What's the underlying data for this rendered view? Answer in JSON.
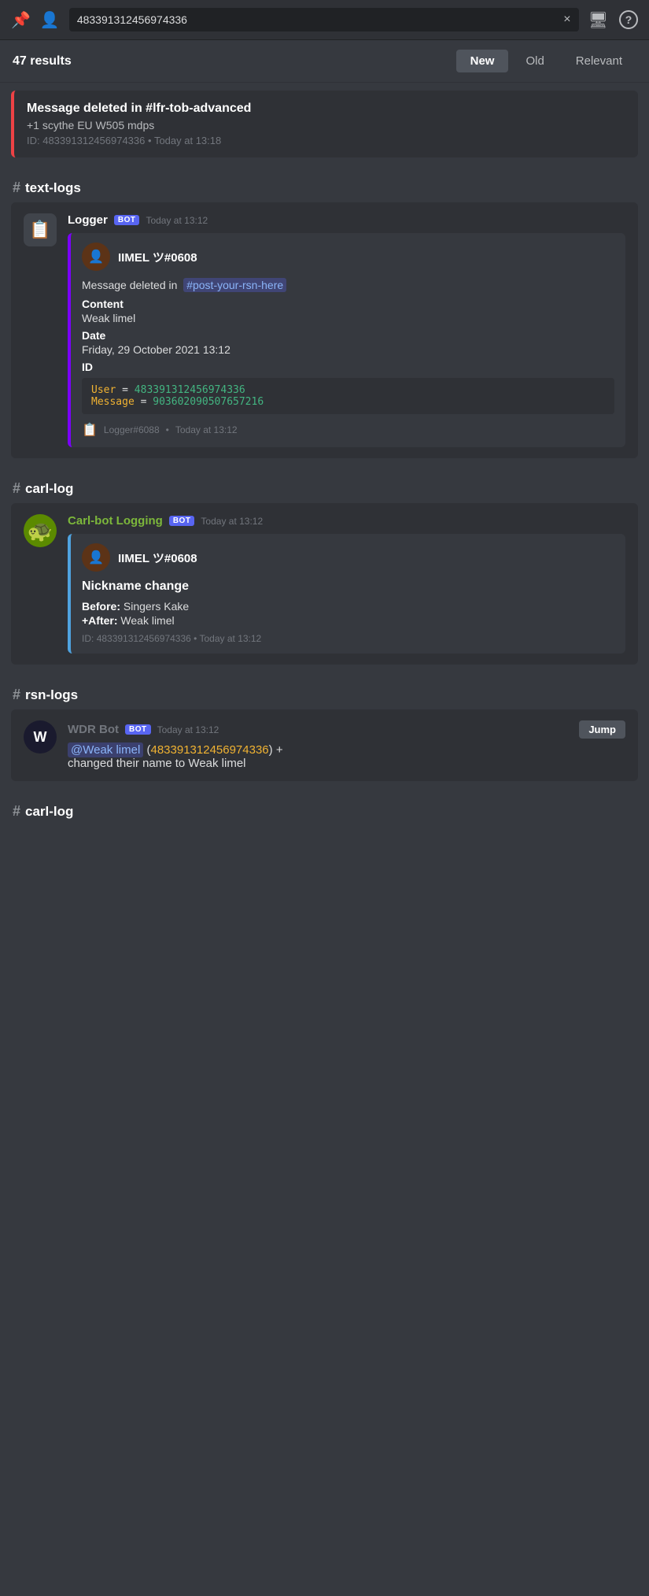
{
  "topbar": {
    "search_value": "483391312456974336",
    "clear_label": "×",
    "chat_icon": "💬",
    "help_icon": "?"
  },
  "results_bar": {
    "count": "47 results",
    "tabs": [
      {
        "label": "New",
        "active": true
      },
      {
        "label": "Old",
        "active": false
      },
      {
        "label": "Relevant",
        "active": false
      }
    ]
  },
  "deleted_snippet": {
    "title": "Message deleted in #lfr-tob-advanced",
    "content": "+1 scythe EU W505 mdps",
    "meta_id": "ID: 483391312456974336",
    "meta_time": "Today at 13:18"
  },
  "text_logs_section": {
    "label": "text-logs",
    "message": {
      "author": "Logger",
      "is_bot": true,
      "time": "Today at 13:12",
      "embed": {
        "border_color": "#7b00ff",
        "user": "IIMEL ツ#0608",
        "deleted_in_prefix": "Message deleted in",
        "channel": "#post-your-rsn-here",
        "content_label": "Content",
        "content_value": "Weak limel",
        "date_label": "Date",
        "date_value": "Friday, 29 October 2021 13:12",
        "id_label": "ID",
        "code_user_label": "User",
        "code_user_value": "483391312456974336",
        "code_msg_label": "Message",
        "code_msg_value": "903602090507657216",
        "footer_author": "Logger#6088",
        "footer_time": "Today at 13:12"
      }
    }
  },
  "carl_log_section_1": {
    "label": "carl-log",
    "message": {
      "author": "Carl-bot Logging",
      "is_bot": true,
      "time": "Today at 13:12",
      "embed": {
        "border_color": "#4fa3e0",
        "user": "IIMEL ツ#0608",
        "title": "Nickname change",
        "before_label": "Before:",
        "before_value": "Singers Kake",
        "after_label": "+After:",
        "after_value": "Weak limel",
        "id_label": "ID:",
        "id_value": "483391312456974336",
        "time": "Today at 13:12"
      }
    }
  },
  "rsn_logs_section": {
    "label": "rsn-logs",
    "message": {
      "author": "WDR Bot",
      "is_bot": true,
      "time": "Today at 13:12",
      "jump_label": "Jump",
      "mention": "@Weak limel",
      "user_id": "483391312456974336",
      "body": "changed their name to Weak limel"
    }
  },
  "carl_log_section_2": {
    "label": "carl-log"
  }
}
